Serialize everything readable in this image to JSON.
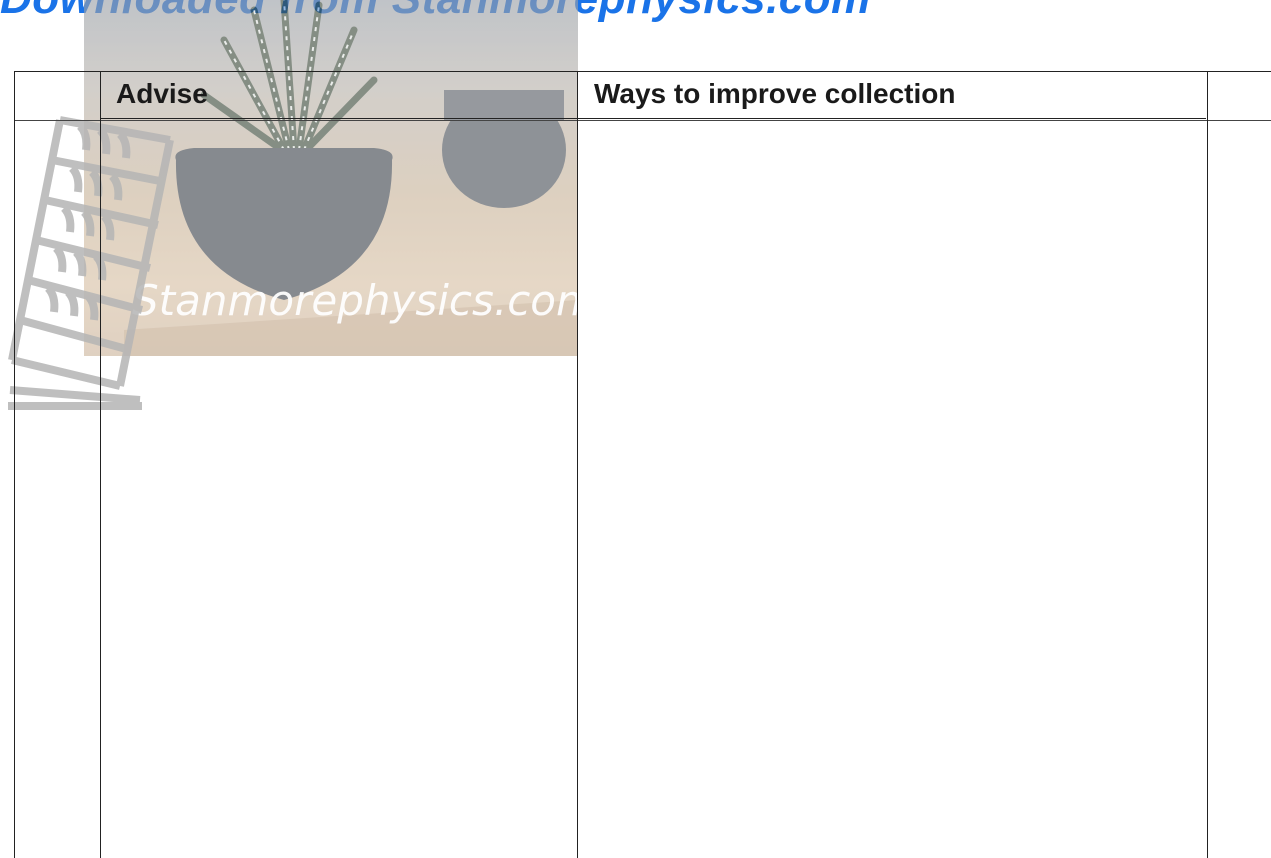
{
  "banner": {
    "text": "Downloaded from Stanmorephysics.com"
  },
  "table": {
    "headers": [
      {
        "label": "Advise"
      },
      {
        "label": "Ways to improve collection"
      }
    ]
  },
  "watermark": {
    "text": "Stanmorephysics.com",
    "icon": "leaning-tower-icon"
  },
  "colors": {
    "banner": "#1a73e8",
    "border": "#222222",
    "text": "#1a1a1a"
  }
}
